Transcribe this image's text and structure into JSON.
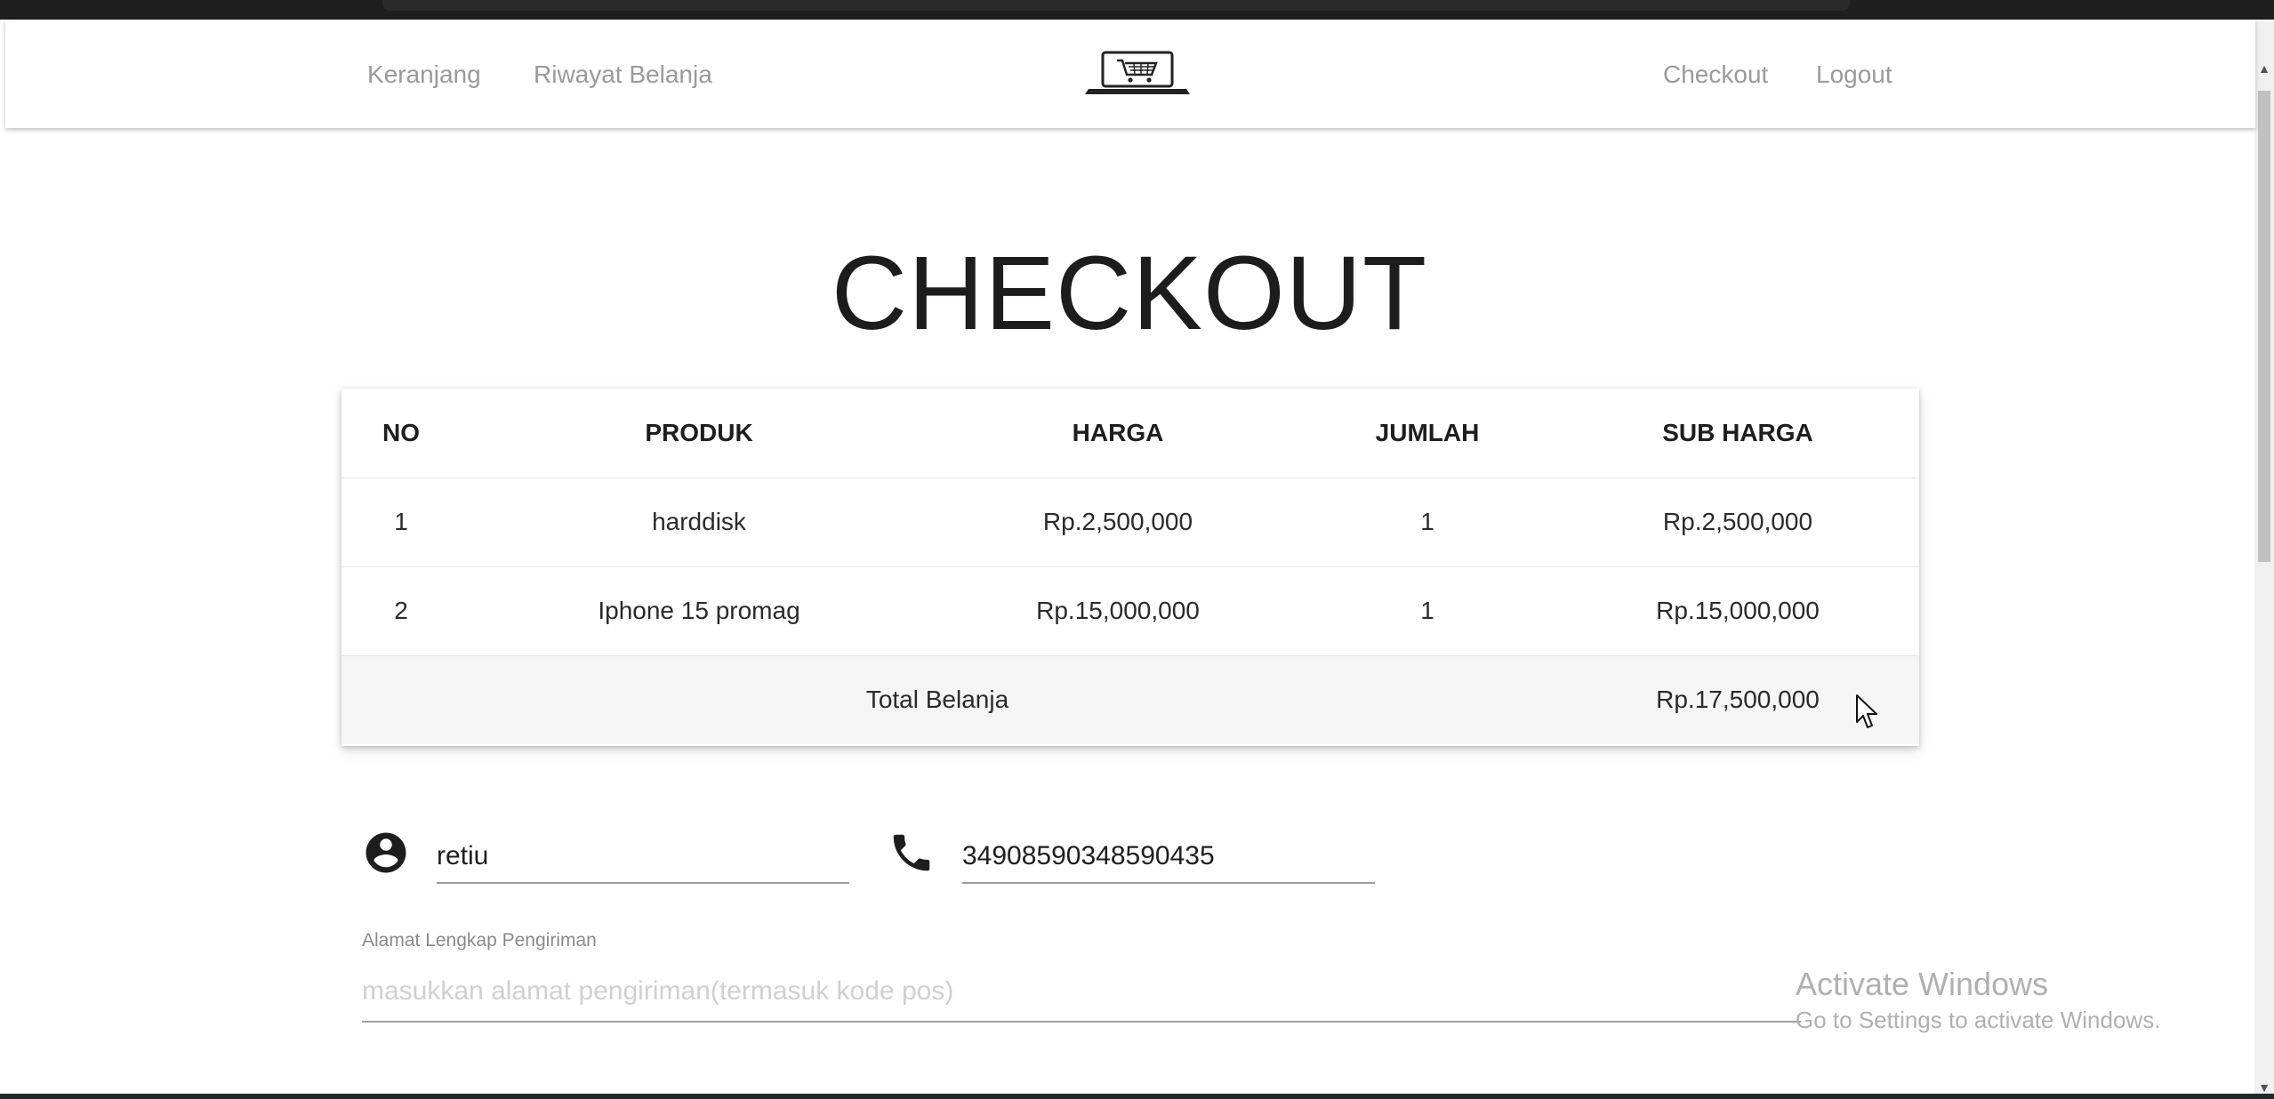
{
  "nav": {
    "keranjang": "Keranjang",
    "riwayat": "Riwayat Belanja",
    "checkout": "Checkout",
    "logout": "Logout",
    "logo_icon": "laptop-cart-icon"
  },
  "page": {
    "title": "CHECKOUT"
  },
  "table": {
    "headers": {
      "no": "NO",
      "produk": "PRODUK",
      "harga": "HARGA",
      "jumlah": "JUMLAH",
      "sub_harga": "SUB HARGA"
    },
    "rows": [
      {
        "no": "1",
        "produk": "harddisk",
        "harga": "Rp.2,500,000",
        "jumlah": "1",
        "sub_harga": "Rp.2,500,000"
      },
      {
        "no": "2",
        "produk": "Iphone 15 promag",
        "harga": "Rp.15,000,000",
        "jumlah": "1",
        "sub_harga": "Rp.15,000,000"
      }
    ],
    "total_label": "Total Belanja",
    "total_value": "Rp.17,500,000"
  },
  "form": {
    "name_value": "retiu",
    "name_icon": "account-circle-icon",
    "phone_value": "34908590348590435",
    "phone_icon": "phone-icon",
    "alamat_label": "Alamat Lengkap Pengiriman",
    "alamat_placeholder": "masukkan alamat pengiriman(termasuk kode pos)"
  },
  "watermark": {
    "title": "Activate Windows",
    "subtitle": "Go to Settings to activate Windows."
  },
  "colors": {
    "nav_link": "#9a9a9a",
    "text": "#1e1e1e",
    "total_row_bg": "#f5f5f5"
  }
}
